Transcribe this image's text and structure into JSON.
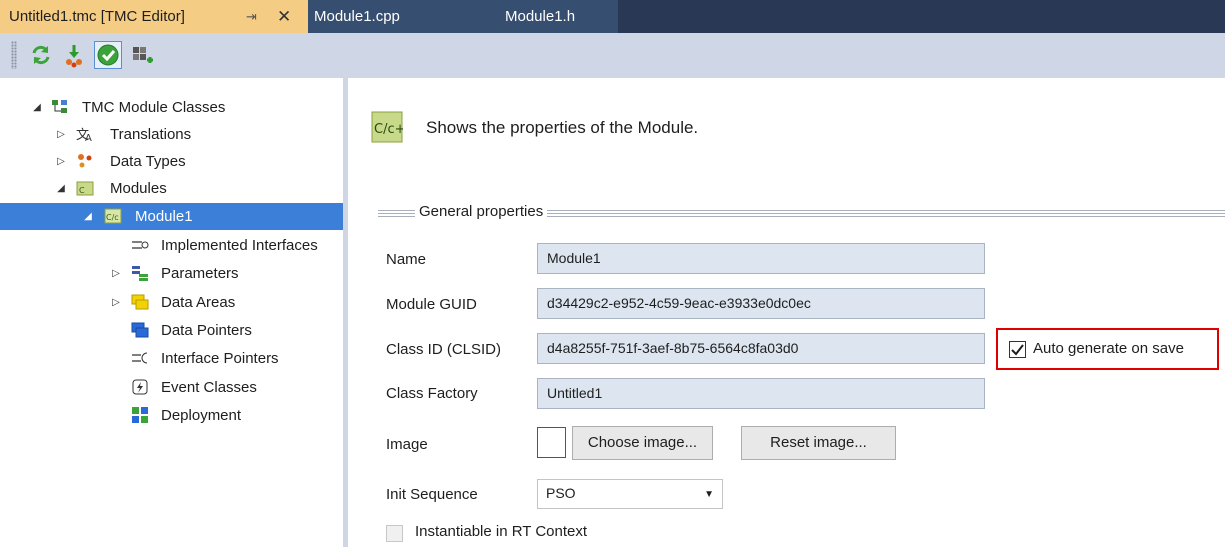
{
  "tabs": [
    {
      "label": "Untitled1.tmc [TMC Editor]",
      "active": true
    },
    {
      "label": "Module1.cpp",
      "active": false
    },
    {
      "label": "Module1.h",
      "active": false
    }
  ],
  "tab_pin_glyph": "⇥",
  "tab_close_glyph": "✕",
  "toolbar": {
    "buttons": [
      {
        "icon": "refresh-icon"
      },
      {
        "icon": "generate-icon"
      },
      {
        "icon": "checkmark-icon",
        "checked": true
      },
      {
        "icon": "deploy-icon"
      }
    ]
  },
  "tree": {
    "root": "TMC Module Classes",
    "translations": "Translations",
    "data_types": "Data Types",
    "modules": "Modules",
    "module1": "Module1",
    "implemented_interfaces": "Implemented Interfaces",
    "parameters": "Parameters",
    "data_areas": "Data Areas",
    "data_pointers": "Data Pointers",
    "interface_pointers": "Interface Pointers",
    "event_classes": "Event Classes",
    "deployment": "Deployment"
  },
  "panel": {
    "description": "Shows the properties of the Module.",
    "group_title": "General properties",
    "name_label": "Name",
    "name_value": "Module1",
    "guid_label": "Module GUID",
    "guid_value": "d34429c2-e952-4c59-9eac-e3933e0dc0ec",
    "clsid_label": "Class ID (CLSID)",
    "clsid_value": "d4a8255f-751f-3aef-8b75-6564c8fa03d0",
    "auto_generate_label": "Auto generate on save",
    "auto_generate_checked": true,
    "factory_label": "Class Factory",
    "factory_value": "Untitled1",
    "image_label": "Image",
    "choose_image": "Choose image...",
    "reset_image": "Reset image...",
    "init_label": "Init Sequence",
    "init_value": "PSO",
    "instantiable_label": "Instantiable in RT Context",
    "instantiable_checked": false
  },
  "colors": {
    "active_tab": "#f5cc84",
    "tabbar": "#293955",
    "selection": "#3b7fd8",
    "field_bg": "#dde6f0",
    "highlight_box": "#e00000"
  }
}
